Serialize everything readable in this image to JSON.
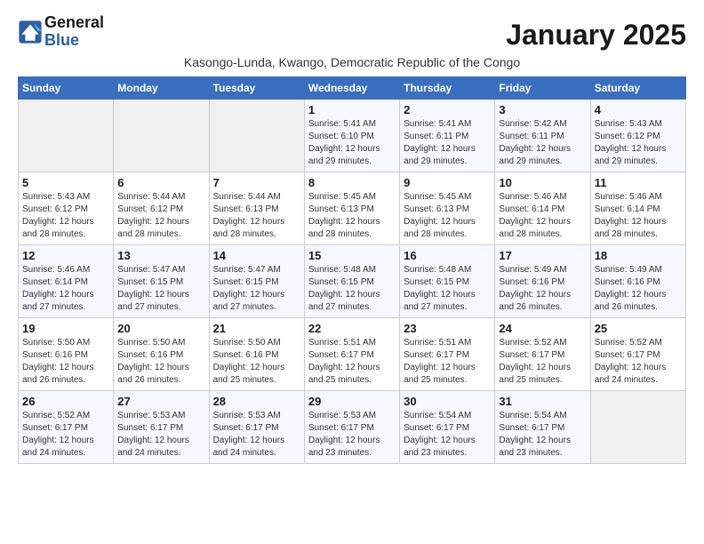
{
  "logo": {
    "line1": "General",
    "line2": "Blue"
  },
  "title": "January 2025",
  "subtitle": "Kasongo-Lunda, Kwango, Democratic Republic of the Congo",
  "days_of_week": [
    "Sunday",
    "Monday",
    "Tuesday",
    "Wednesday",
    "Thursday",
    "Friday",
    "Saturday"
  ],
  "weeks": [
    [
      {
        "day": "",
        "info": ""
      },
      {
        "day": "",
        "info": ""
      },
      {
        "day": "",
        "info": ""
      },
      {
        "day": "1",
        "info": "Sunrise: 5:41 AM\nSunset: 6:10 PM\nDaylight: 12 hours\nand 29 minutes."
      },
      {
        "day": "2",
        "info": "Sunrise: 5:41 AM\nSunset: 6:11 PM\nDaylight: 12 hours\nand 29 minutes."
      },
      {
        "day": "3",
        "info": "Sunrise: 5:42 AM\nSunset: 6:11 PM\nDaylight: 12 hours\nand 29 minutes."
      },
      {
        "day": "4",
        "info": "Sunrise: 5:43 AM\nSunset: 6:12 PM\nDaylight: 12 hours\nand 29 minutes."
      }
    ],
    [
      {
        "day": "5",
        "info": "Sunrise: 5:43 AM\nSunset: 6:12 PM\nDaylight: 12 hours\nand 28 minutes."
      },
      {
        "day": "6",
        "info": "Sunrise: 5:44 AM\nSunset: 6:12 PM\nDaylight: 12 hours\nand 28 minutes."
      },
      {
        "day": "7",
        "info": "Sunrise: 5:44 AM\nSunset: 6:13 PM\nDaylight: 12 hours\nand 28 minutes."
      },
      {
        "day": "8",
        "info": "Sunrise: 5:45 AM\nSunset: 6:13 PM\nDaylight: 12 hours\nand 28 minutes."
      },
      {
        "day": "9",
        "info": "Sunrise: 5:45 AM\nSunset: 6:13 PM\nDaylight: 12 hours\nand 28 minutes."
      },
      {
        "day": "10",
        "info": "Sunrise: 5:46 AM\nSunset: 6:14 PM\nDaylight: 12 hours\nand 28 minutes."
      },
      {
        "day": "11",
        "info": "Sunrise: 5:46 AM\nSunset: 6:14 PM\nDaylight: 12 hours\nand 28 minutes."
      }
    ],
    [
      {
        "day": "12",
        "info": "Sunrise: 5:46 AM\nSunset: 6:14 PM\nDaylight: 12 hours\nand 27 minutes."
      },
      {
        "day": "13",
        "info": "Sunrise: 5:47 AM\nSunset: 6:15 PM\nDaylight: 12 hours\nand 27 minutes."
      },
      {
        "day": "14",
        "info": "Sunrise: 5:47 AM\nSunset: 6:15 PM\nDaylight: 12 hours\nand 27 minutes."
      },
      {
        "day": "15",
        "info": "Sunrise: 5:48 AM\nSunset: 6:15 PM\nDaylight: 12 hours\nand 27 minutes."
      },
      {
        "day": "16",
        "info": "Sunrise: 5:48 AM\nSunset: 6:15 PM\nDaylight: 12 hours\nand 27 minutes."
      },
      {
        "day": "17",
        "info": "Sunrise: 5:49 AM\nSunset: 6:16 PM\nDaylight: 12 hours\nand 26 minutes."
      },
      {
        "day": "18",
        "info": "Sunrise: 5:49 AM\nSunset: 6:16 PM\nDaylight: 12 hours\nand 26 minutes."
      }
    ],
    [
      {
        "day": "19",
        "info": "Sunrise: 5:50 AM\nSunset: 6:16 PM\nDaylight: 12 hours\nand 26 minutes."
      },
      {
        "day": "20",
        "info": "Sunrise: 5:50 AM\nSunset: 6:16 PM\nDaylight: 12 hours\nand 26 minutes."
      },
      {
        "day": "21",
        "info": "Sunrise: 5:50 AM\nSunset: 6:16 PM\nDaylight: 12 hours\nand 25 minutes."
      },
      {
        "day": "22",
        "info": "Sunrise: 5:51 AM\nSunset: 6:17 PM\nDaylight: 12 hours\nand 25 minutes."
      },
      {
        "day": "23",
        "info": "Sunrise: 5:51 AM\nSunset: 6:17 PM\nDaylight: 12 hours\nand 25 minutes."
      },
      {
        "day": "24",
        "info": "Sunrise: 5:52 AM\nSunset: 6:17 PM\nDaylight: 12 hours\nand 25 minutes."
      },
      {
        "day": "25",
        "info": "Sunrise: 5:52 AM\nSunset: 6:17 PM\nDaylight: 12 hours\nand 24 minutes."
      }
    ],
    [
      {
        "day": "26",
        "info": "Sunrise: 5:52 AM\nSunset: 6:17 PM\nDaylight: 12 hours\nand 24 minutes."
      },
      {
        "day": "27",
        "info": "Sunrise: 5:53 AM\nSunset: 6:17 PM\nDaylight: 12 hours\nand 24 minutes."
      },
      {
        "day": "28",
        "info": "Sunrise: 5:53 AM\nSunset: 6:17 PM\nDaylight: 12 hours\nand 24 minutes."
      },
      {
        "day": "29",
        "info": "Sunrise: 5:53 AM\nSunset: 6:17 PM\nDaylight: 12 hours\nand 23 minutes."
      },
      {
        "day": "30",
        "info": "Sunrise: 5:54 AM\nSunset: 6:17 PM\nDaylight: 12 hours\nand 23 minutes."
      },
      {
        "day": "31",
        "info": "Sunrise: 5:54 AM\nSunset: 6:17 PM\nDaylight: 12 hours\nand 23 minutes."
      },
      {
        "day": "",
        "info": ""
      }
    ]
  ]
}
